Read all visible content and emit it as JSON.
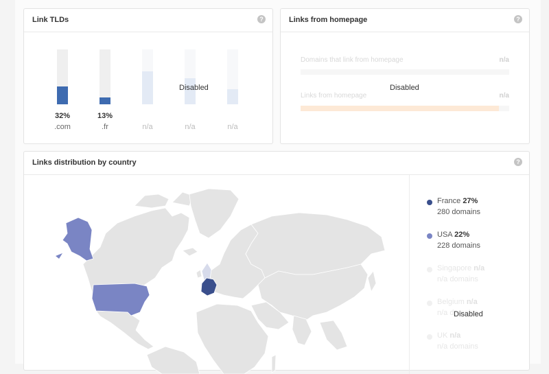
{
  "link_tlds": {
    "title": "Link TLDs",
    "help": "?",
    "disabled": "Disabled",
    "bars": [
      {
        "label": ".com",
        "pct_text": "32%",
        "value": 32
      },
      {
        "label": ".fr",
        "pct_text": "13%",
        "value": 13
      }
    ],
    "disabled_bars": [
      {
        "label": "n/a",
        "value": 60
      },
      {
        "label": "n/a",
        "value": 48
      },
      {
        "label": "n/a",
        "value": 28
      }
    ]
  },
  "homepage": {
    "title": "Links from homepage",
    "help": "?",
    "disabled": "Disabled",
    "rows": [
      {
        "label": "Domains that link from homepage",
        "value": "n/a",
        "fill": 0
      },
      {
        "label": "Links from homepage",
        "value": "n/a",
        "fill": 95
      }
    ]
  },
  "country": {
    "title": "Links distribution by country",
    "help": "?",
    "disabled": "Disabled",
    "legend": [
      {
        "name": "France",
        "pct": "27%",
        "domains": "280 domains",
        "color": "#3a4f8c",
        "active": true
      },
      {
        "name": "USA",
        "pct": "22%",
        "domains": "228 domains",
        "color": "#7a85c4",
        "active": true
      },
      {
        "name": "Singapore",
        "pct": "n/a",
        "domains": "n/a domains",
        "color": "#f0f0f0",
        "active": false
      },
      {
        "name": "Belgium",
        "pct": "n/a",
        "domains": "n/a domains",
        "color": "#f0f0f0",
        "active": false
      },
      {
        "name": "UK",
        "pct": "n/a",
        "domains": "n/a domains",
        "color": "#f0f0f0",
        "active": false
      }
    ]
  }
}
